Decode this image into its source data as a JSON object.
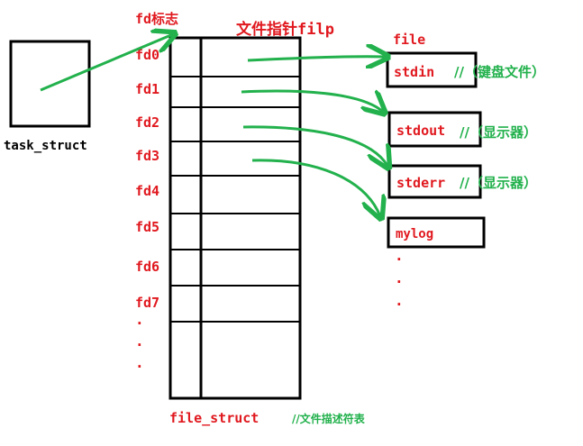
{
  "task": {
    "label": "task_struct"
  },
  "fd_header": "fd标志",
  "filp_header": "文件指针filp",
  "file_header": "file",
  "fd_labels": [
    "fd0",
    "fd1",
    "fd2",
    "fd3",
    "fd4",
    "fd5",
    "fd6",
    "fd7"
  ],
  "file_struct_label": "file_struct",
  "file_struct_comment": "//文件描述符表",
  "files": [
    {
      "name": "stdin",
      "comment": "//（键盘文件）"
    },
    {
      "name": "stdout",
      "comment": "//（显示器）"
    },
    {
      "name": "stderr",
      "comment": "//（显示器）"
    },
    {
      "name": "mylog",
      "comment": ""
    }
  ],
  "ellipsis": "·",
  "colors": {
    "red": "#e0191f",
    "green": "#22b14c",
    "black": "#000000"
  }
}
